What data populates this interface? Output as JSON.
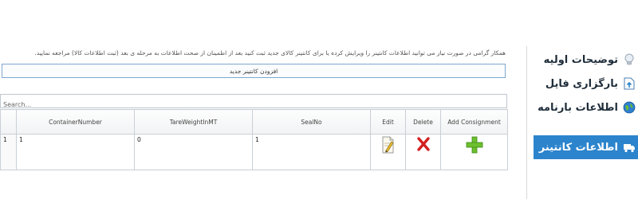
{
  "notice": "همکار گرامی در صورت نیاز می توانید اطلاعات کانتینر را ویرایش کرده یا برای کانتینر کالای جدید ثبت کنید بعد از اطمینان از صحت اطلاعات به مرحله ی بعد (ثبت اطلاعات کالا) مراجعه نمایید.",
  "new_container_button": "افزودن کانتینر جدید",
  "search": {
    "placeholder": "Search..."
  },
  "table": {
    "headers": {
      "container_number": "ContainerNumber",
      "tare_weight": "TareWeightInMT",
      "seal_no": "SealNo",
      "edit": "Edit",
      "delete": "Delete",
      "add_consignment": "Add Consignment"
    },
    "rows": [
      {
        "row_number": "1",
        "container_number": "1",
        "tare_weight": "0",
        "seal_no": "1"
      }
    ]
  },
  "sidebar": {
    "items": [
      {
        "label": "توضیحات اولیه",
        "icon": "lightbulb-icon"
      },
      {
        "label": "بارگزاری فایل",
        "icon": "file-upload-icon"
      },
      {
        "label": "اطلاعات بارنامه",
        "icon": "globe-icon"
      },
      {
        "label": "اطلاعات کانتینر",
        "icon": "truck-icon",
        "active": true
      }
    ]
  },
  "colors": {
    "active_nav": "#2c84cc",
    "delete_icon": "#d42020",
    "add_icon": "#6cbf2e",
    "button_border": "#7fa7cf"
  }
}
